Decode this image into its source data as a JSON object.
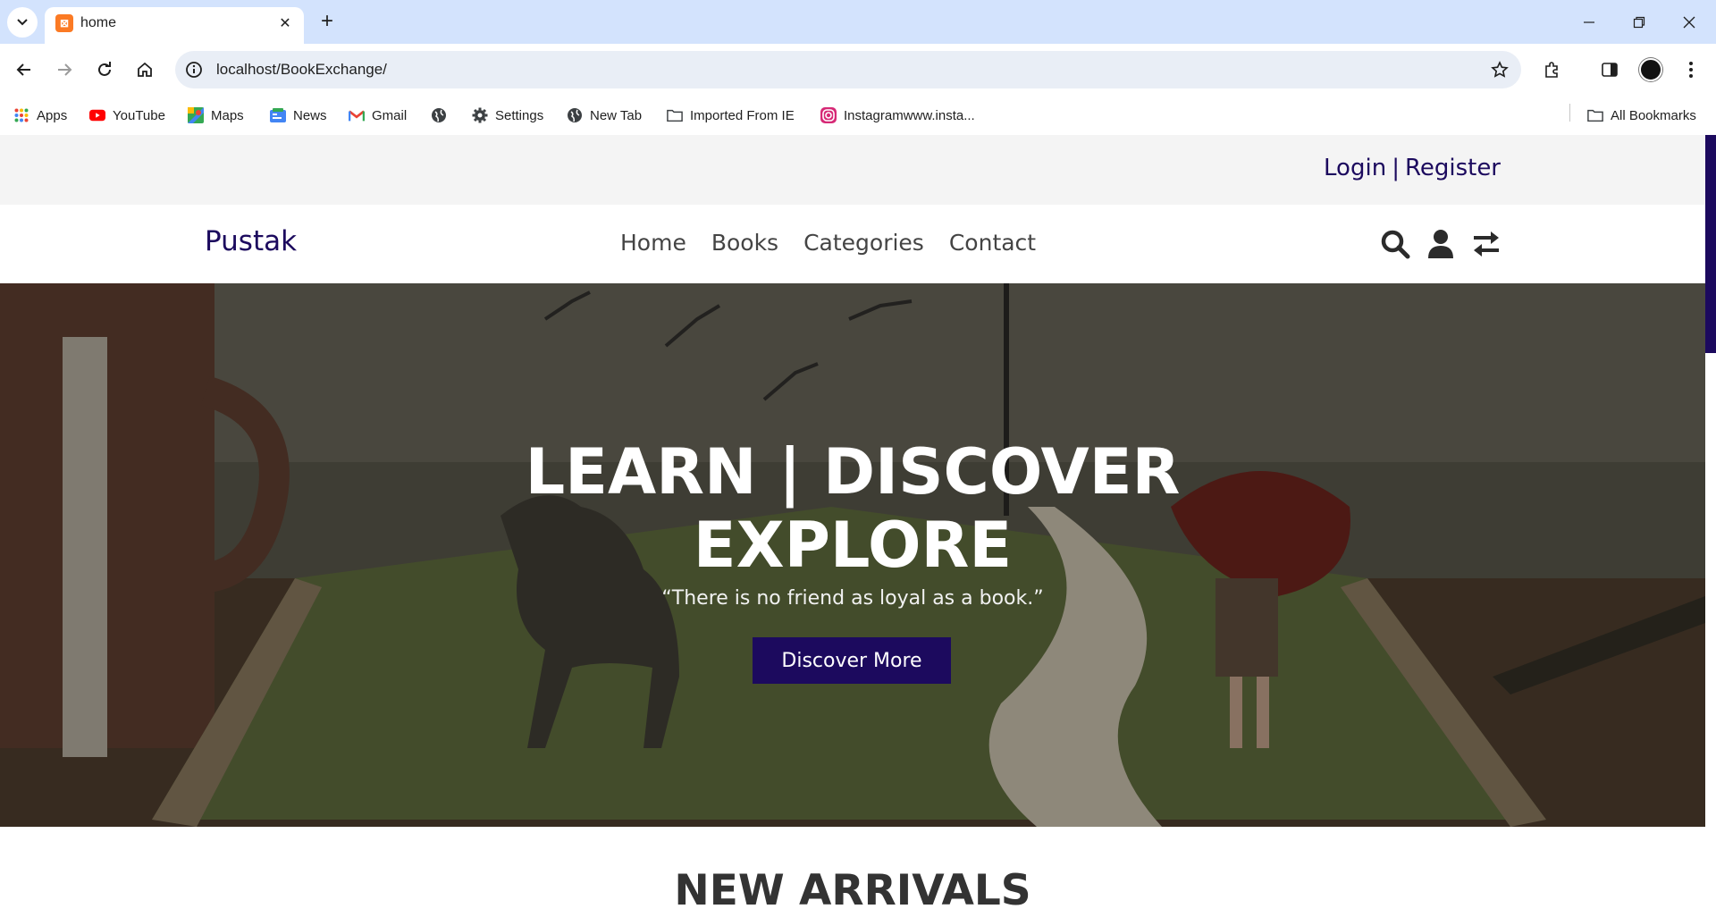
{
  "browser": {
    "tab_title": "home",
    "url": "localhost/BookExchange/",
    "bookmarks": [
      {
        "label": "Apps",
        "icon": "apps-grid-icon"
      },
      {
        "label": "YouTube",
        "icon": "youtube-icon"
      },
      {
        "label": "Maps",
        "icon": "maps-icon"
      },
      {
        "label": "News",
        "icon": "news-icon"
      },
      {
        "label": "Gmail",
        "icon": "gmail-icon"
      },
      {
        "label": "",
        "icon": "globe-icon"
      },
      {
        "label": "Settings",
        "icon": "gear-icon"
      },
      {
        "label": "New Tab",
        "icon": "globe-icon"
      },
      {
        "label": "Imported From IE",
        "icon": "folder-icon"
      },
      {
        "label": "Instagramwww.insta...",
        "icon": "instagram-icon"
      }
    ],
    "all_bookmarks": "All Bookmarks"
  },
  "site": {
    "auth": {
      "login": "Login",
      "separator": "|",
      "register": "Register"
    },
    "logo": "Pustak",
    "nav": [
      "Home",
      "Books",
      "Categories",
      "Contact"
    ],
    "icons": [
      "search-icon",
      "user-icon",
      "exchange-icon"
    ],
    "hero": {
      "title_line1": "LEARN | DISCOVER",
      "title_line2": "EXPLORE",
      "quote": "“There is no friend as loyal as a book.”",
      "button": "Discover More"
    },
    "section_title": "NEW ARRIVALS",
    "colors": {
      "brand": "#1c0a5e",
      "nav_text": "#444444",
      "topbar_bg": "#f4f4f4"
    }
  }
}
